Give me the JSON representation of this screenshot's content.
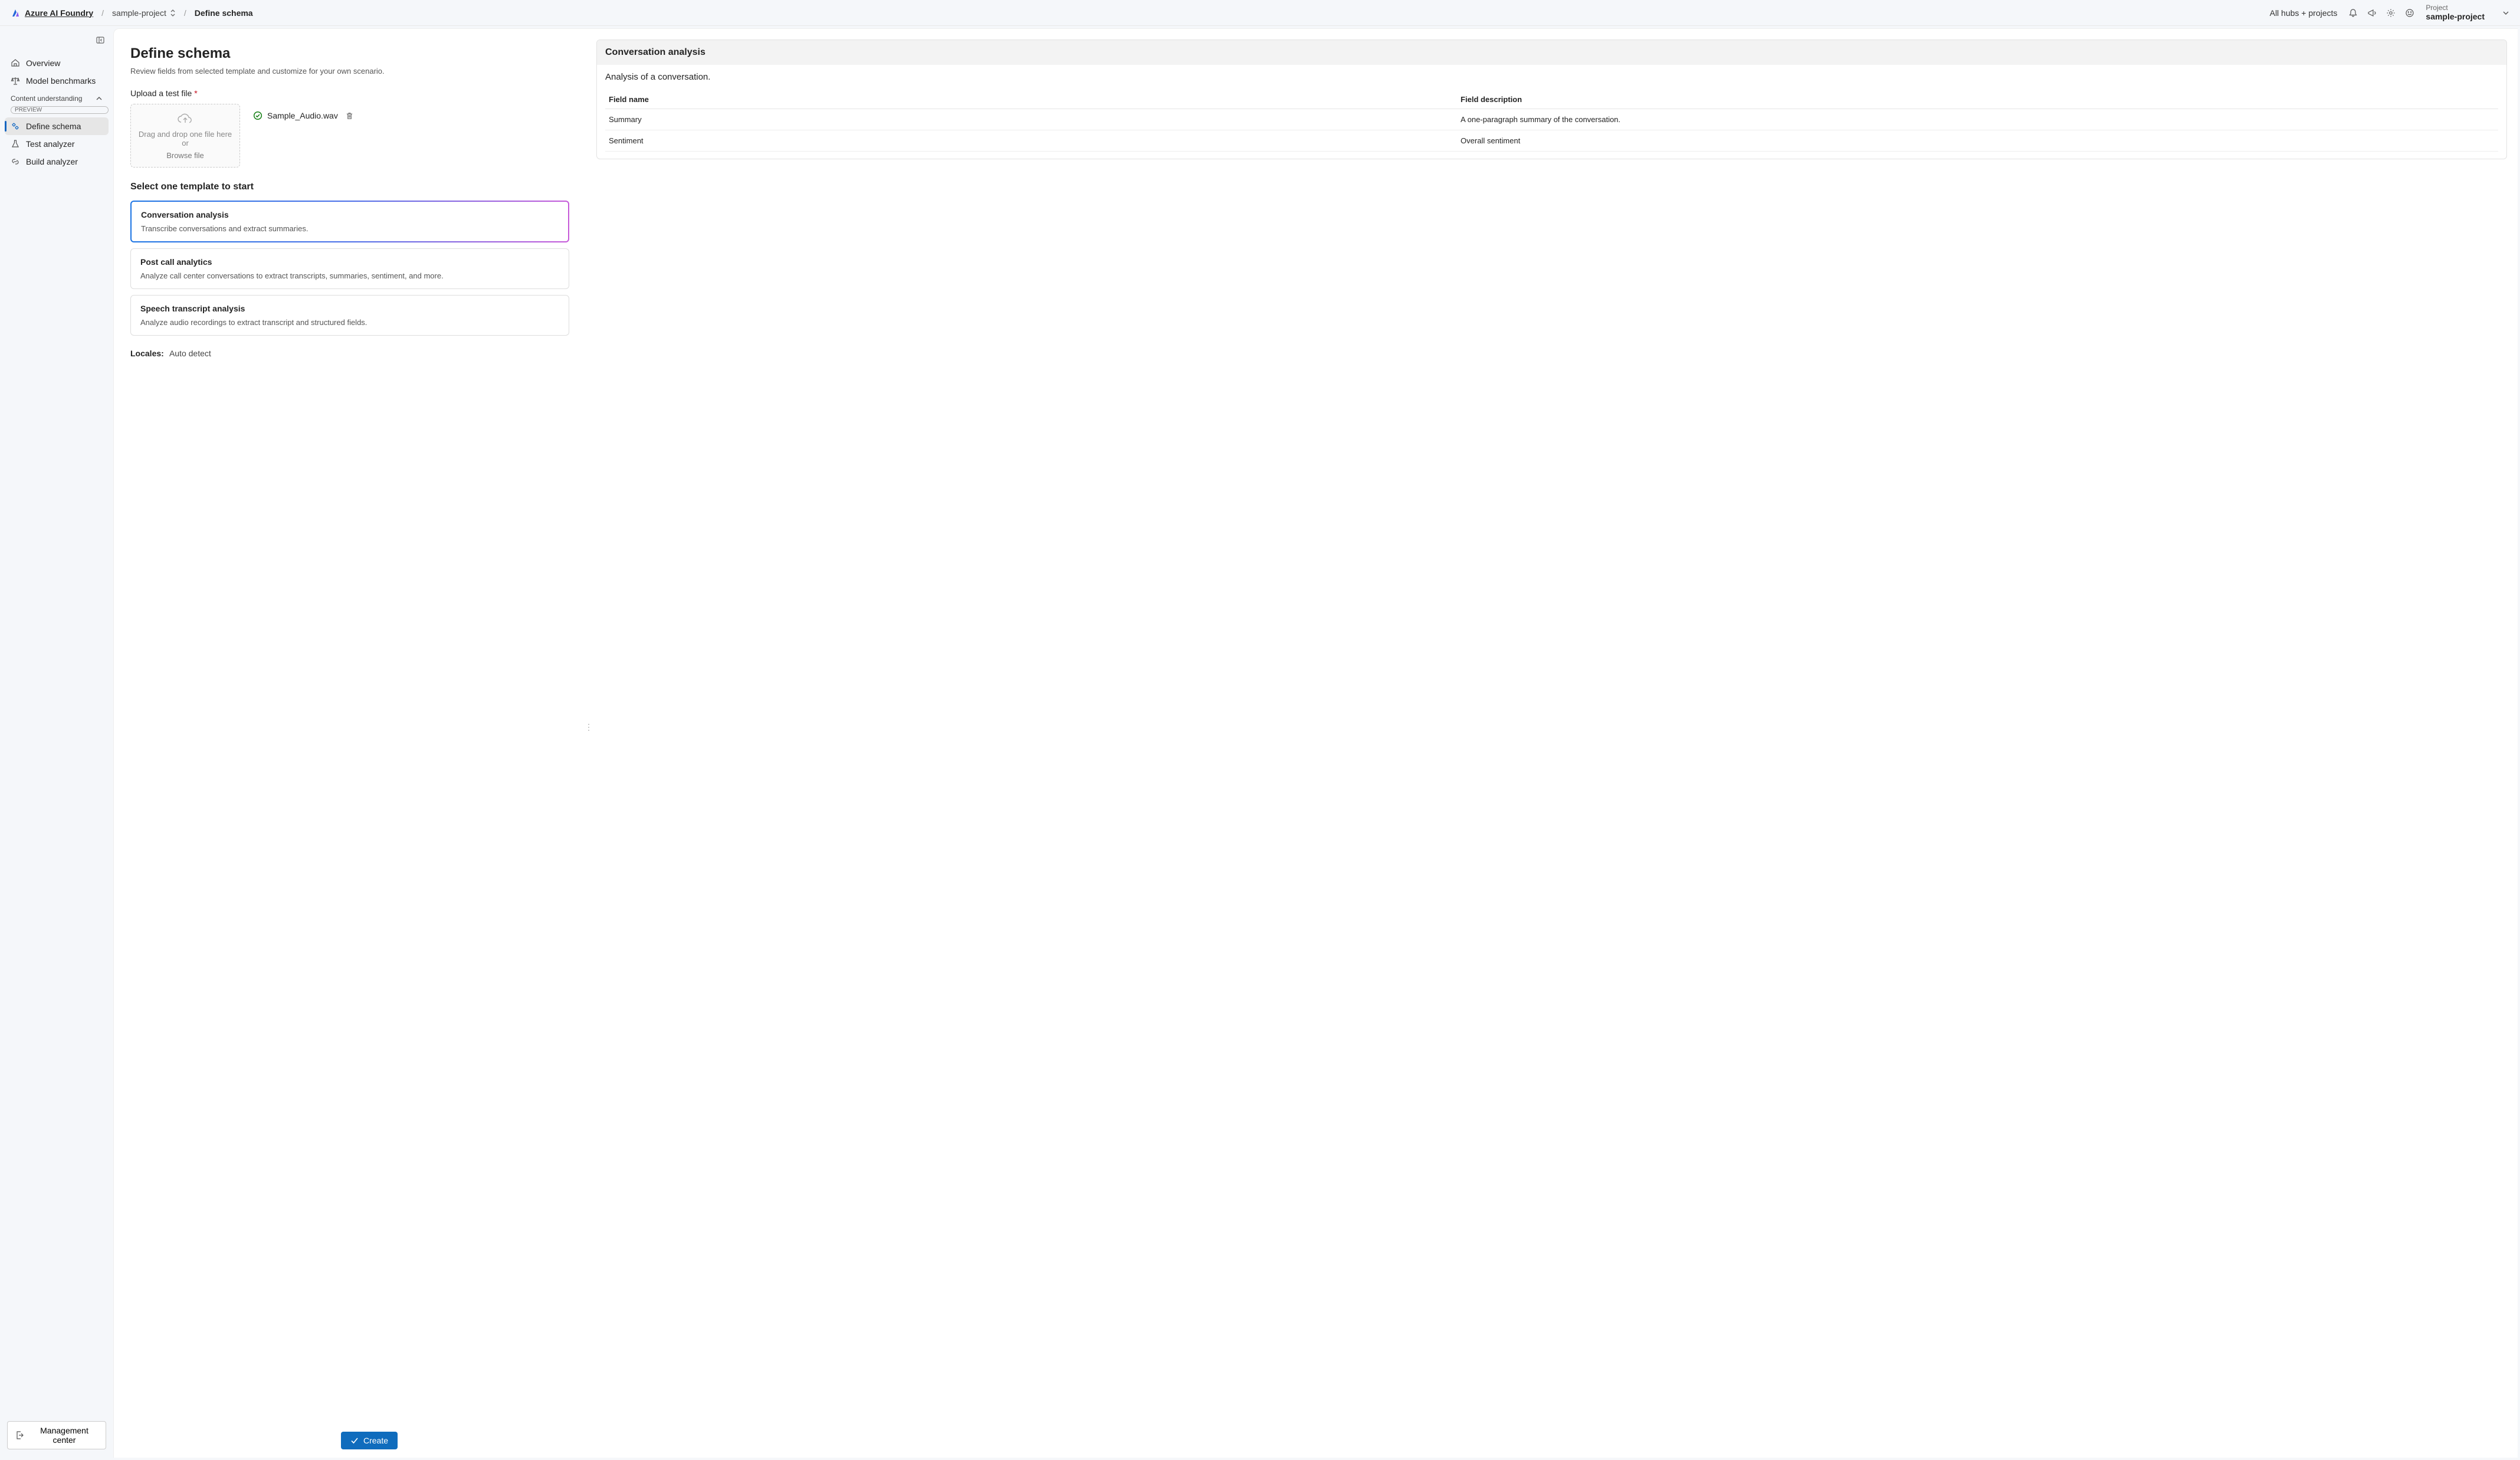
{
  "topbar": {
    "brand": "Azure AI Foundry",
    "project_crumb": "sample-project",
    "current_crumb": "Define schema",
    "hubs_label": "All hubs + projects",
    "project_label": "Project",
    "project_name": "sample-project"
  },
  "sidebar": {
    "overview": "Overview",
    "model_benchmarks": "Model benchmarks",
    "group_title": "Content understanding",
    "group_badge": "PREVIEW",
    "define_schema": "Define schema",
    "test_analyzer": "Test analyzer",
    "build_analyzer": "Build analyzer",
    "management_center": "Management center"
  },
  "main": {
    "title": "Define schema",
    "subtitle": "Review fields from selected template and customize for your own scenario.",
    "upload_label": "Upload a test file",
    "dropzone_text": "Drag and drop one file here or",
    "dropzone_browse": "Browse file",
    "uploaded_filename": "Sample_Audio.wav",
    "templates_title": "Select one template to start",
    "templates": [
      {
        "title": "Conversation analysis",
        "desc": "Transcribe conversations and extract summaries."
      },
      {
        "title": "Post call analytics",
        "desc": "Analyze call center conversations to extract transcripts, summaries, sentiment, and more."
      },
      {
        "title": "Speech transcript analysis",
        "desc": "Analyze audio recordings to extract transcript and structured fields."
      }
    ],
    "locales_label": "Locales:",
    "locales_value": "Auto detect",
    "create_label": "Create"
  },
  "info": {
    "header": "Conversation analysis",
    "subtitle": "Analysis of a conversation.",
    "col_name": "Field name",
    "col_desc": "Field description",
    "rows": [
      {
        "name": "Summary",
        "desc": "A one-paragraph summary of the conversation."
      },
      {
        "name": "Sentiment",
        "desc": "Overall sentiment"
      }
    ]
  }
}
